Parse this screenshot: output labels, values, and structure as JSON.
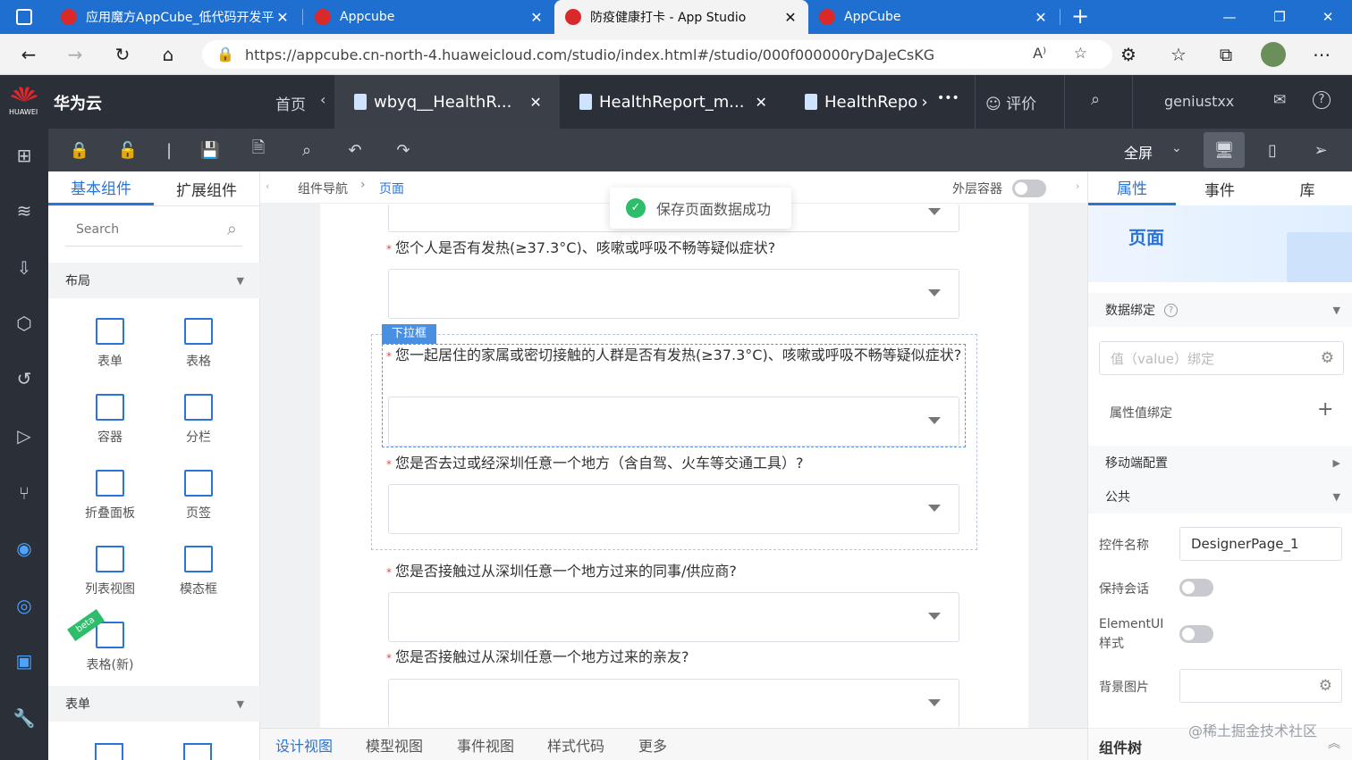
{
  "browser": {
    "tabs": [
      {
        "title": "应用魔方AppCube_低代码开发平"
      },
      {
        "title": "Appcube"
      },
      {
        "title": "防疫健康打卡 - App Studio"
      },
      {
        "title": "AppCube"
      }
    ],
    "url": "https://appcube.cn-north-4.huaweicloud.com/studio/index.html#/studio/000f000000ryDaJeCsKG"
  },
  "header": {
    "brand": "华为云",
    "logo_text": "HUAWEI",
    "home": "首页",
    "tabs": [
      "wbyq__HealthR...",
      "HealthReport_m...",
      "HealthRepo"
    ],
    "more": "•••",
    "rate": "评价",
    "username": "geniustxx"
  },
  "toolbar": {
    "fullscreen": "全屏"
  },
  "left_panel": {
    "tabs": [
      "基本组件",
      "扩展组件"
    ],
    "search_placeholder": "Search",
    "section_layout": "布局",
    "components": [
      "表单",
      "表格",
      "容器",
      "分栏",
      "折叠面板",
      "页签",
      "列表视图",
      "模态框",
      "表格(新)"
    ],
    "beta": "beta",
    "section_form": "表单"
  },
  "canvas": {
    "breadcrumb": [
      "组件导航",
      "页面"
    ],
    "outer_container": "外层容器",
    "toast": "保存页面数据成功",
    "badge": "下拉框",
    "questions": [
      "您个人是否有发热(≥37.3°C)、咳嗽或呼吸不畅等疑似症状?",
      "您一起居住的家属或密切接触的人群是否有发热(≥37.3°C)、咳嗽或呼吸不畅等疑似症状?",
      "您是否去过或经深圳任意一个地方（含自驾、火车等交通工具）?",
      "您是否接触过从深圳任意一个地方过来的同事/供应商?",
      "您是否接触过从深圳任意一个地方过来的亲友?"
    ]
  },
  "bottom_tabs": [
    "设计视图",
    "模型视图",
    "事件视图",
    "样式代码",
    "更多"
  ],
  "right_panel": {
    "tabs": [
      "属性",
      "事件",
      "库"
    ],
    "banner_title": "页面",
    "data_binding": "数据绑定",
    "value_binding_placeholder": "值（value）绑定",
    "attr_binding": "属性值绑定",
    "mobile_config": "移动端配置",
    "common": "公共",
    "control_name_label": "控件名称",
    "control_name_value": "DesignerPage_1",
    "keep_session": "保持会话",
    "elementui_style": "ElementUI样式",
    "bg_image": "背景图片",
    "component_tree": "组件树"
  },
  "watermark": "@稀土掘金技术社区",
  "colors": {
    "accent": "#2a73d8",
    "dark_header": "#2a2f38",
    "toolbar": "#3b4049",
    "browser_tab_bar": "#1f6fd1"
  }
}
